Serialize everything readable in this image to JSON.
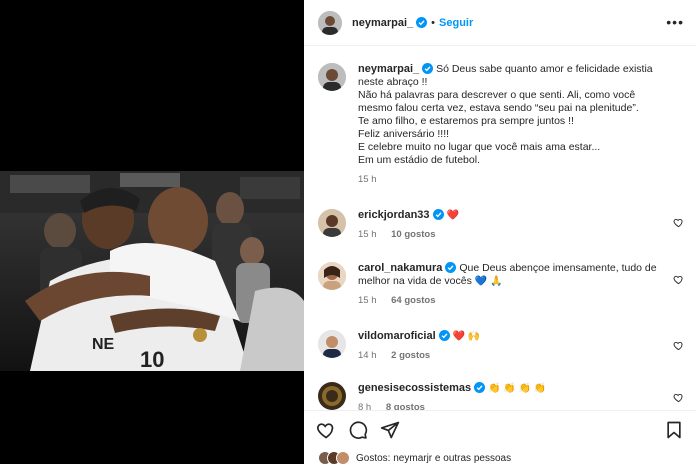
{
  "post": {
    "username": "neymarpai_",
    "follow_label": "Seguir",
    "more_label": "•••",
    "dot": "•",
    "caption_lines": [
      "Só Deus sabe quanto amor e felicidade existia",
      "neste abraço !!",
      "Não há palavras para descrever o que senti. Ali, como você",
      "mesmo falou certa vez, estava sendo “seu pai na plenitude”.",
      "Te amo filho, e estaremos pra sempre juntos !!",
      "Feliz aniversário !!!!",
      "E celebre muito no lugar que você mais ama estar...",
      "Em um estádio de futebol."
    ],
    "caption_time": "15 h"
  },
  "comments": [
    {
      "username": "erickjordan33",
      "text": "",
      "emoji": "❤️",
      "time": "15 h",
      "likes": "10 gostos"
    },
    {
      "username": "carol_nakamura",
      "text": "Que Deus abençoe imensamente, tudo de melhor na vida de vocês",
      "emoji": "💙 🙏",
      "time": "15 h",
      "likes": "64 gostos"
    },
    {
      "username": "vildomaroficial",
      "text": "",
      "emoji": "❤️ 🙌",
      "time": "14 h",
      "likes": "2 gostos"
    },
    {
      "username": "genesisecossistemas",
      "text": "",
      "emoji": "👏 👏 👏 👏",
      "time": "8 h",
      "likes": "8 gostos"
    }
  ],
  "footer": {
    "liked_by": "Gostos: neymarjr e outras pessoas"
  },
  "icons": [
    "verified-icon",
    "heart-icon",
    "comment-icon",
    "share-icon",
    "bookmark-icon"
  ],
  "colors": {
    "accent": "#0095f6",
    "verified": "#0095f6",
    "heart": "#ed4956",
    "muted": "#737373"
  }
}
